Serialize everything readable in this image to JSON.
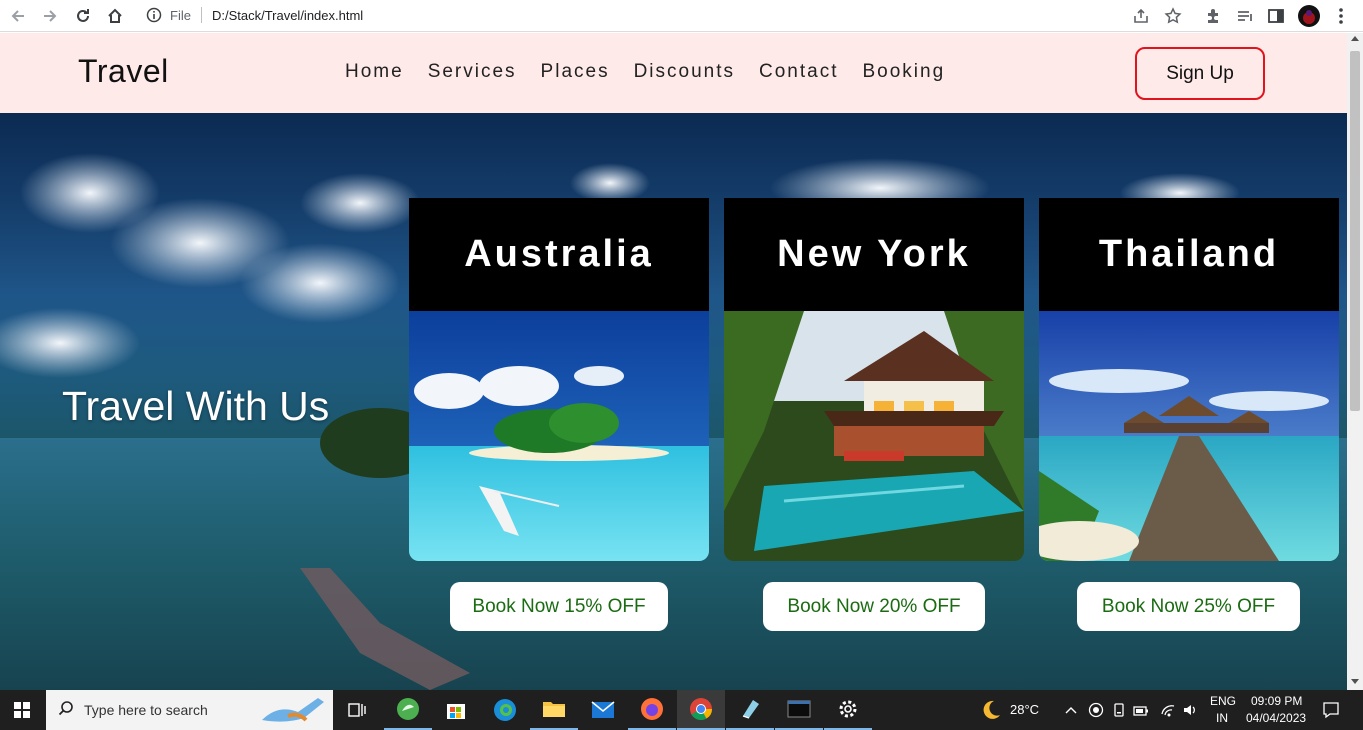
{
  "browser": {
    "file_label": "File",
    "url": "D:/Stack/Travel/index.html",
    "icons": [
      "back-icon",
      "forward-icon",
      "reload-icon",
      "home-icon",
      "info-icon",
      "share-icon",
      "star-icon",
      "extensions-icon",
      "reading-list-icon",
      "side-panel-icon",
      "profile-avatar",
      "more-icon"
    ]
  },
  "site": {
    "brand": "Travel",
    "nav": [
      {
        "label": "Home"
      },
      {
        "label": "Services"
      },
      {
        "label": "Places"
      },
      {
        "label": "Discounts"
      },
      {
        "label": "Contact"
      },
      {
        "label": "Booking"
      }
    ],
    "signup_label": "Sign Up",
    "hero_title": "Travel With Us",
    "cards": [
      {
        "title": "Australia",
        "button": "Book Now 15% OFF"
      },
      {
        "title": "New York",
        "button": "Book Now 20% OFF"
      },
      {
        "title": "Thailand",
        "button": "Book Now 25% OFF"
      }
    ],
    "colors": {
      "header_bg": "#ffeaea",
      "signup_border": "#e0141c",
      "button_text": "#1a6b12",
      "card_head_bg": "#000000"
    }
  },
  "taskbar": {
    "search_placeholder": "Type here to search",
    "weather": "28°C",
    "lang_top": "ENG",
    "lang_bottom": "IN",
    "time": "09:09 PM",
    "date": "04/04/2023",
    "apps": [
      "task-view-icon",
      "green-app-icon",
      "store-icon",
      "edge-icon",
      "file-explorer-icon",
      "mail-icon",
      "firefox-icon",
      "chrome-icon",
      "notepad-icon",
      "terminal-icon",
      "settings-icon"
    ]
  }
}
